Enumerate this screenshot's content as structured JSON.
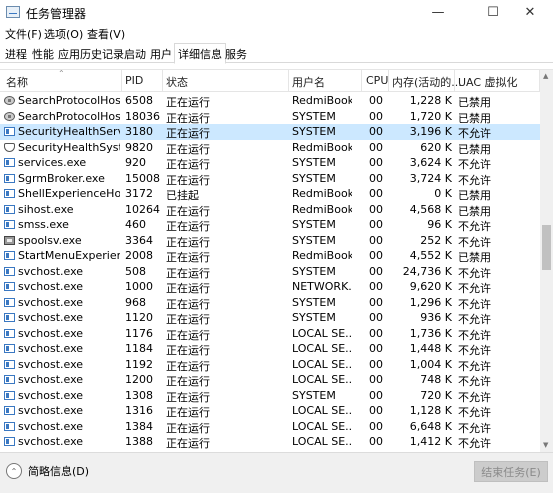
{
  "window": {
    "title": "任务管理器",
    "minimize_glyph": "—",
    "maximize_glyph": "☐",
    "close_glyph": "✕"
  },
  "menu": [
    "文件(F)",
    "选项(O)",
    "查看(V)"
  ],
  "tabs": [
    "进程",
    "性能",
    "应用历史记录",
    "启动",
    "用户",
    "详细信息",
    "服务"
  ],
  "active_tab": "详细信息",
  "columns": {
    "name": "名称",
    "pid": "PID",
    "status": "状态",
    "user": "用户名",
    "cpu": "CPU",
    "mem": "内存(活动的...",
    "uac": "UAC 虚拟化"
  },
  "rows": [
    {
      "name": "SearchProtocolHost...",
      "pid": "6508",
      "status": "正在运行",
      "user": "RedmiBook",
      "cpu": "00",
      "mem": "1,228 K",
      "uac": "已禁用",
      "icon": "gear-icon"
    },
    {
      "name": "SearchProtocolHost...",
      "pid": "18036",
      "status": "正在运行",
      "user": "SYSTEM",
      "cpu": "00",
      "mem": "1,720 K",
      "uac": "已禁用",
      "icon": "gear-icon"
    },
    {
      "name": "SecurityHealthServi...",
      "pid": "3180",
      "status": "正在运行",
      "user": "SYSTEM",
      "cpu": "00",
      "mem": "3,196 K",
      "uac": "不允许",
      "icon": "window-icon"
    },
    {
      "name": "SecurityHealthSystr...",
      "pid": "9820",
      "status": "正在运行",
      "user": "RedmiBook",
      "cpu": "00",
      "mem": "620 K",
      "uac": "已禁用",
      "icon": "shield-icon"
    },
    {
      "name": "services.exe",
      "pid": "920",
      "status": "正在运行",
      "user": "SYSTEM",
      "cpu": "00",
      "mem": "3,624 K",
      "uac": "不允许",
      "icon": "window-icon"
    },
    {
      "name": "SgrmBroker.exe",
      "pid": "15008",
      "status": "正在运行",
      "user": "SYSTEM",
      "cpu": "00",
      "mem": "3,724 K",
      "uac": "不允许",
      "icon": "window-icon"
    },
    {
      "name": "ShellExperienceHos...",
      "pid": "3172",
      "status": "已挂起",
      "user": "RedmiBook",
      "cpu": "00",
      "mem": "0 K",
      "uac": "已禁用",
      "icon": "window-icon"
    },
    {
      "name": "sihost.exe",
      "pid": "10264",
      "status": "正在运行",
      "user": "RedmiBook",
      "cpu": "00",
      "mem": "4,568 K",
      "uac": "已禁用",
      "icon": "window-icon"
    },
    {
      "name": "smss.exe",
      "pid": "460",
      "status": "正在运行",
      "user": "SYSTEM",
      "cpu": "00",
      "mem": "96 K",
      "uac": "不允许",
      "icon": "window-icon"
    },
    {
      "name": "spoolsv.exe",
      "pid": "3364",
      "status": "正在运行",
      "user": "SYSTEM",
      "cpu": "00",
      "mem": "252 K",
      "uac": "不允许",
      "icon": "printer-icon"
    },
    {
      "name": "StartMenuExperien...",
      "pid": "2008",
      "status": "正在运行",
      "user": "RedmiBook",
      "cpu": "00",
      "mem": "4,552 K",
      "uac": "已禁用",
      "icon": "window-icon"
    },
    {
      "name": "svchost.exe",
      "pid": "508",
      "status": "正在运行",
      "user": "SYSTEM",
      "cpu": "00",
      "mem": "24,736 K",
      "uac": "不允许",
      "icon": "window-icon"
    },
    {
      "name": "svchost.exe",
      "pid": "1000",
      "status": "正在运行",
      "user": "NETWORK...",
      "cpu": "00",
      "mem": "9,620 K",
      "uac": "不允许",
      "icon": "window-icon"
    },
    {
      "name": "svchost.exe",
      "pid": "968",
      "status": "正在运行",
      "user": "SYSTEM",
      "cpu": "00",
      "mem": "1,296 K",
      "uac": "不允许",
      "icon": "window-icon"
    },
    {
      "name": "svchost.exe",
      "pid": "1120",
      "status": "正在运行",
      "user": "SYSTEM",
      "cpu": "00",
      "mem": "936 K",
      "uac": "不允许",
      "icon": "window-icon"
    },
    {
      "name": "svchost.exe",
      "pid": "1176",
      "status": "正在运行",
      "user": "LOCAL SE...",
      "cpu": "00",
      "mem": "1,736 K",
      "uac": "不允许",
      "icon": "window-icon"
    },
    {
      "name": "svchost.exe",
      "pid": "1184",
      "status": "正在运行",
      "user": "LOCAL SE...",
      "cpu": "00",
      "mem": "1,448 K",
      "uac": "不允许",
      "icon": "window-icon"
    },
    {
      "name": "svchost.exe",
      "pid": "1192",
      "status": "正在运行",
      "user": "LOCAL SE...",
      "cpu": "00",
      "mem": "1,004 K",
      "uac": "不允许",
      "icon": "window-icon"
    },
    {
      "name": "svchost.exe",
      "pid": "1200",
      "status": "正在运行",
      "user": "LOCAL SE...",
      "cpu": "00",
      "mem": "748 K",
      "uac": "不允许",
      "icon": "window-icon"
    },
    {
      "name": "svchost.exe",
      "pid": "1308",
      "status": "正在运行",
      "user": "SYSTEM",
      "cpu": "00",
      "mem": "720 K",
      "uac": "不允许",
      "icon": "window-icon"
    },
    {
      "name": "svchost.exe",
      "pid": "1316",
      "status": "正在运行",
      "user": "LOCAL SE...",
      "cpu": "00",
      "mem": "1,128 K",
      "uac": "不允许",
      "icon": "window-icon"
    },
    {
      "name": "svchost.exe",
      "pid": "1384",
      "status": "正在运行",
      "user": "LOCAL SE...",
      "cpu": "00",
      "mem": "6,648 K",
      "uac": "不允许",
      "icon": "window-icon"
    },
    {
      "name": "svchost.exe",
      "pid": "1388",
      "status": "正在运行",
      "user": "LOCAL SE...",
      "cpu": "00",
      "mem": "1,412 K",
      "uac": "不允许",
      "icon": "window-icon"
    }
  ],
  "selected_row": 2,
  "footer": {
    "fewer_details": "简略信息(D)",
    "end_task": "结束任务(E)"
  }
}
